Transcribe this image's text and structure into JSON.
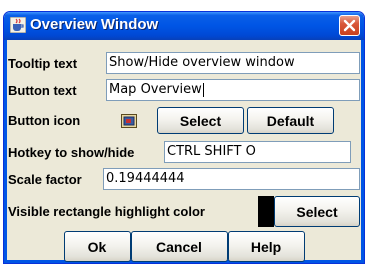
{
  "window": {
    "title": "Overview Window"
  },
  "rows": {
    "tooltip": {
      "label": "Tooltip text",
      "value": "Show/Hide overview window"
    },
    "button_text": {
      "label": "Button text",
      "value": "Map Overview"
    },
    "button_icon": {
      "label": "Button icon",
      "select_label": "Select",
      "default_label": "Default"
    },
    "hotkey": {
      "label": "Hotkey to show/hide",
      "value": "CTRL SHIFT O"
    },
    "scale": {
      "label": "Scale factor",
      "value": "0.19444444"
    },
    "highlight": {
      "label": "Visible rectangle highlight color",
      "select_label": "Select",
      "color": "#000000"
    }
  },
  "footer": {
    "ok_label": "Ok",
    "cancel_label": "Cancel",
    "help_label": "Help"
  },
  "icons": {
    "title": "java-cup-icon",
    "close": "close-icon",
    "button_icon_preview": "map-overview-icon"
  },
  "colors": {
    "titlebar": "#0055e5",
    "window_bg": "#ece9d8",
    "close_button": "#d9583b"
  }
}
